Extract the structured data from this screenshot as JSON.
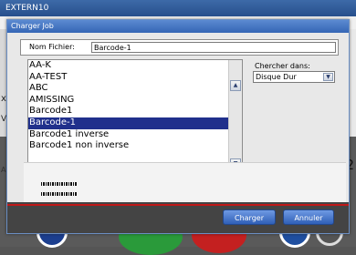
{
  "app": {
    "title": "EXTERN10"
  },
  "dialog": {
    "title": "Charger Job",
    "name_label": "Nom Fichier:",
    "name_value": "Barcode-1",
    "files": [
      {
        "label": "AA-K",
        "selected": false
      },
      {
        "label": "AA-TEST",
        "selected": false
      },
      {
        "label": "ABC",
        "selected": false
      },
      {
        "label": "AMISSING",
        "selected": false
      },
      {
        "label": "Barcode1",
        "selected": false
      },
      {
        "label": "Barcode-1",
        "selected": true
      },
      {
        "label": "Barcode1 inverse",
        "selected": false
      },
      {
        "label": "Barcode1 non inverse",
        "selected": false
      }
    ],
    "search_label": "Chercher dans:",
    "search_value": "Disque Dur",
    "ok_label": "Charger",
    "cancel_label": "Annuler"
  },
  "background": {
    "side_number": "2",
    "x_mark": "x",
    "vi_mark": "Vi",
    "a_mark": "A"
  },
  "colors": {
    "selection": "#20308c",
    "title_bar": "#3566b5",
    "button": "#2f5fb6",
    "accent_red": "#c01818"
  }
}
